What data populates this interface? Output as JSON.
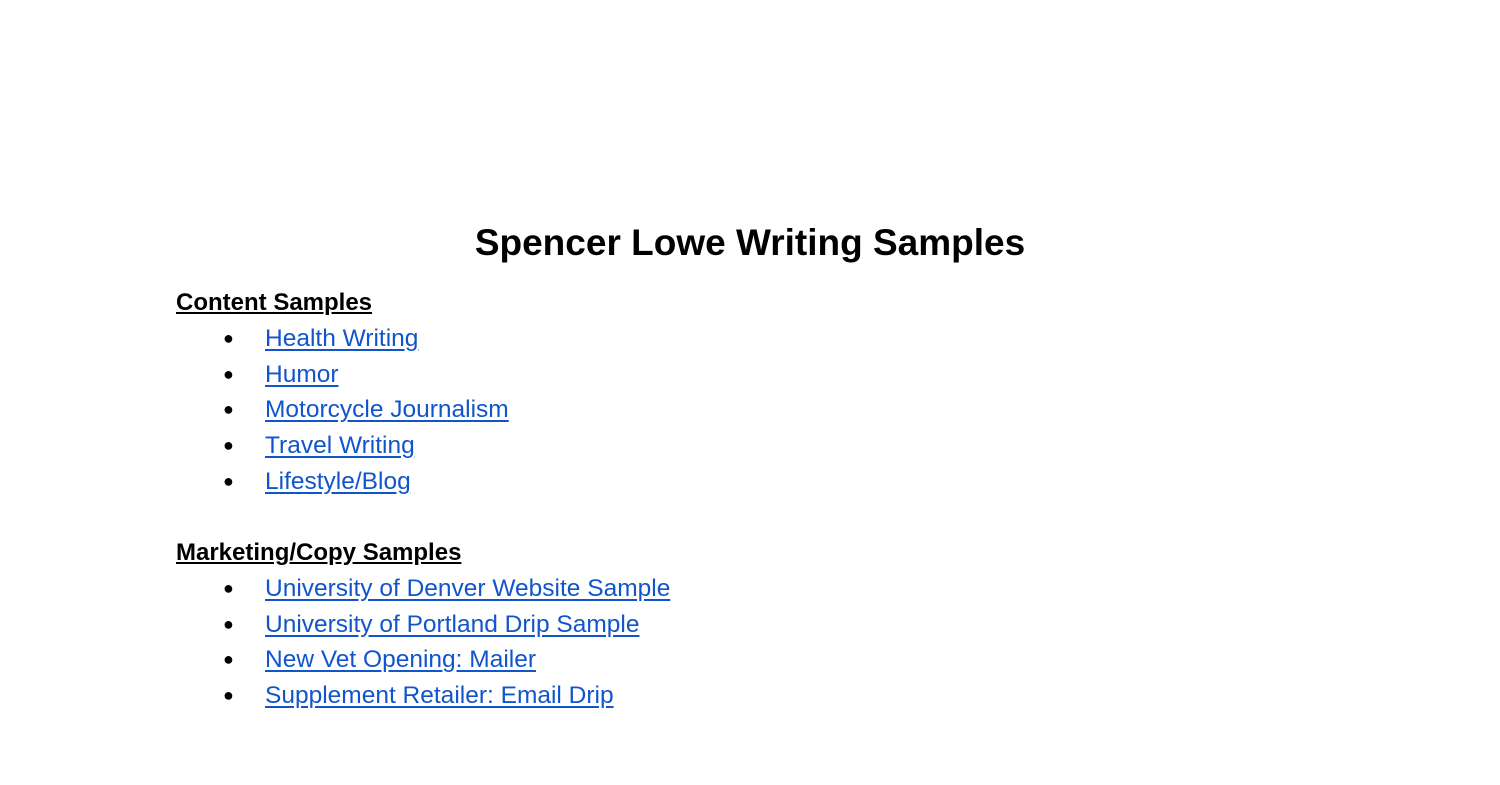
{
  "title": "Spencer Lowe Writing Samples",
  "sections": [
    {
      "heading": "Content Samples",
      "items": [
        "Health Writing",
        "Humor",
        "Motorcycle Journalism",
        "Travel Writing",
        "Lifestyle/Blog"
      ]
    },
    {
      "heading": "Marketing/Copy Samples",
      "items": [
        "University of Denver Website Sample",
        "University of Portland Drip Sample",
        "New Vet Opening: Mailer",
        "Supplement Retailer: Email Drip"
      ]
    }
  ],
  "colors": {
    "link": "#1155cc",
    "text": "#000000"
  },
  "bullet_icon": "●"
}
